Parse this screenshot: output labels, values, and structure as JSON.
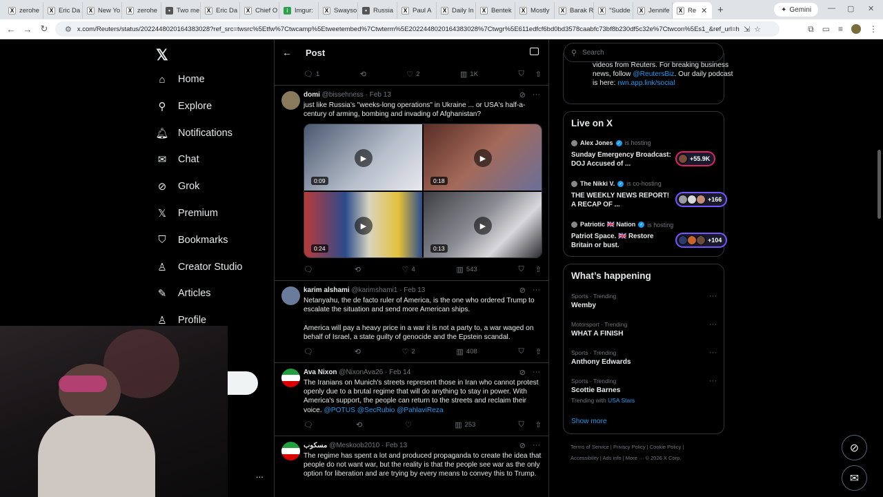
{
  "browser": {
    "tabs": [
      {
        "label": "zerohe",
        "icon": "x"
      },
      {
        "label": "Eric Da",
        "icon": "x"
      },
      {
        "label": "New Yo",
        "icon": "x"
      },
      {
        "label": "zerohe",
        "icon": "x"
      },
      {
        "label": "Two me",
        "icon": "r"
      },
      {
        "label": "Eric Da",
        "icon": "x"
      },
      {
        "label": "Chief O",
        "icon": "x"
      },
      {
        "label": "Imgur:",
        "icon": "g"
      },
      {
        "label": "Swayso",
        "icon": "x"
      },
      {
        "label": "Russia",
        "icon": "r"
      },
      {
        "label": "Paul A",
        "icon": "x"
      },
      {
        "label": "Daily In",
        "icon": "x"
      },
      {
        "label": "Bentek",
        "icon": "x"
      },
      {
        "label": "Mostly",
        "icon": "x"
      },
      {
        "label": "Barak R",
        "icon": "x"
      },
      {
        "label": "\"Sudde",
        "icon": "x"
      },
      {
        "label": "Jennife",
        "icon": "x"
      },
      {
        "label": "Re",
        "icon": "x"
      }
    ],
    "gemini_label": "Gemini",
    "url": "x.com/Reuters/status/2022448020164383028?ref_src=twsrc%5Etfw%7Ctwcamp%5Etweetembed%7Ctwterm%5E2022448020164383028%7Ctwgr%5E611edfcf6bd0bd3578caabfc73bf8b230df5c32e%7Ctwcon%5Es1_&ref_url=http%3A%2..."
  },
  "nav": {
    "items": [
      {
        "label": "Home",
        "icon": "home-icon",
        "glyph": "⌂"
      },
      {
        "label": "Explore",
        "icon": "search-icon",
        "glyph": "⚲"
      },
      {
        "label": "Notifications",
        "icon": "bell-icon",
        "glyph": "🔔︎"
      },
      {
        "label": "Chat",
        "icon": "mail-icon",
        "glyph": "✉"
      },
      {
        "label": "Grok",
        "icon": "grok-icon",
        "glyph": "⊘"
      },
      {
        "label": "Premium",
        "icon": "x-logo-icon",
        "glyph": "𝕏"
      },
      {
        "label": "Bookmarks",
        "icon": "bookmark-icon",
        "glyph": "⛉"
      },
      {
        "label": "Creator Studio",
        "icon": "creator-icon",
        "glyph": "♙"
      },
      {
        "label": "Articles",
        "icon": "article-icon",
        "glyph": "✎"
      },
      {
        "label": "Profile",
        "icon": "profile-icon",
        "glyph": "♙"
      }
    ],
    "more": "..."
  },
  "main": {
    "title": "Post",
    "top_actions": {
      "replies": "1",
      "reposts": "",
      "likes": "2",
      "views": "1K"
    },
    "tweets": [
      {
        "name": "domi",
        "handle": "@bissehness",
        "date": "· Feb 13",
        "text": "just like Russia's \"weeks-long operations\" in Ukraine ... or USA's half-a-century of arming, bombing and invading of Afghanistan?",
        "videos": [
          "0:09",
          "0:18",
          "0:24",
          "0:13"
        ],
        "replies": "",
        "reposts": "",
        "likes": "4",
        "views": "543"
      },
      {
        "name": "karim alshami",
        "handle": "@karimshami1",
        "date": "· Feb 13",
        "text": "Netanyahu, the de facto ruler of America, is the one who ordered Trump to escalate the situation and send more American ships.",
        "text2": "America will pay a heavy price in a war it is not a party to, a war waged on behalf of Israel, a state guilty of genocide and the Epstein scandal.",
        "replies": "",
        "reposts": "",
        "likes": "2",
        "views": "408"
      },
      {
        "name": "Ava Nixon",
        "handle": "@NixonAva26",
        "date": "· Feb 14",
        "text": "The Iranians on Munich's streets represent those in Iran who cannot protest openly due to a brutal regime that will do anything to stay in power. With America's support, the people can return to the streets and reclaim their voice.",
        "mentions": "@POTUS @SecRubio @PahlaviReza",
        "replies": "",
        "reposts": "",
        "likes": "",
        "views": "253"
      },
      {
        "name": "مسكوب",
        "handle": "@Meskoob2010",
        "date": "· Feb 13",
        "text": "The regime has spent a lot and produced propaganda to create the idea that people do not want war, but the reality is that the people see war as the only option for liberation and are trying by every means to convey this to Trump."
      }
    ]
  },
  "right": {
    "search_placeholder": "Search",
    "bio": {
      "line1": "videos from Reuters. For breaking business news, follow ",
      "handle": "@ReutersBiz",
      "line2": ". Our daily podcast is here: ",
      "link": "rwn.app.link/social"
    },
    "live": {
      "title": "Live on X",
      "items": [
        {
          "host": "Alex Jones",
          "status": "is hosting",
          "title": "Sunday Emergency Broadcast: DOJ Accused of ...",
          "count": "+55.9K"
        },
        {
          "host": "The Nikki V.",
          "status": "is co-hosting",
          "title": "THE WEEKLY NEWS REPORT! A RECAP OF ...",
          "count": "+166"
        },
        {
          "host": "Patriotic 🇬🇧 Nation",
          "status": "is hosting",
          "title": "Patriot Space. 🇬🇧 Restore Britain or bust.",
          "count": "+104"
        }
      ]
    },
    "happening": {
      "title": "What’s happening",
      "items": [
        {
          "category": "Sports · Trending",
          "name": "Wemby"
        },
        {
          "category": "Motorsport · Trending",
          "name": "WHAT A FINISH"
        },
        {
          "category": "Sports · Trending",
          "name": "Anthony Edwards"
        },
        {
          "category": "Sports · Trending",
          "name": "Scottie Barnes",
          "sub": "Trending with ",
          "sub_link": "USA Stars"
        }
      ],
      "show_more": "Show more"
    },
    "footer": {
      "line1": "Terms of Service  |  Privacy Policy  |  Cookie Policy  |",
      "line2": "Accessibility  |  Ads info  |  More ···  © 2026 X Corp."
    }
  }
}
